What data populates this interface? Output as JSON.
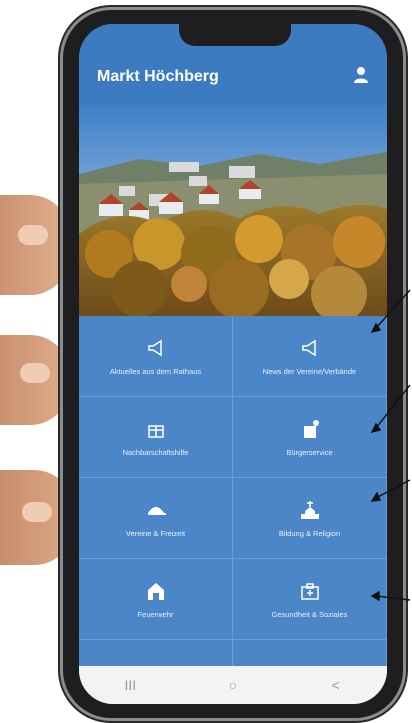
{
  "app": {
    "title": "Markt Höchberg"
  },
  "tiles": [
    {
      "label": "Aktuelles aus dem Rathaus",
      "icon": "megaphone-icon"
    },
    {
      "label": "News der Vereine/Verbände",
      "icon": "megaphone-icon"
    },
    {
      "label": "Nachbarschaftshilfe",
      "icon": "gift-icon"
    },
    {
      "label": "Bürgerservice",
      "icon": "document-icon"
    },
    {
      "label": "Vereine & Freizeit",
      "icon": "cap-icon"
    },
    {
      "label": "Bildung & Religion",
      "icon": "church-icon"
    },
    {
      "label": "Feuerwehr",
      "icon": "firehouse-icon"
    },
    {
      "label": "Gesundheit & Soziales",
      "icon": "hospital-icon"
    },
    {
      "label": "",
      "icon": "network-icon"
    },
    {
      "label": "",
      "icon": "calendar-icon"
    }
  ],
  "navbar": {
    "recent": "III",
    "home": "○",
    "back": "<"
  },
  "colors": {
    "primary": "#3d7bc0",
    "tile": "#4a86c8",
    "divider": "#6d9fd6"
  }
}
